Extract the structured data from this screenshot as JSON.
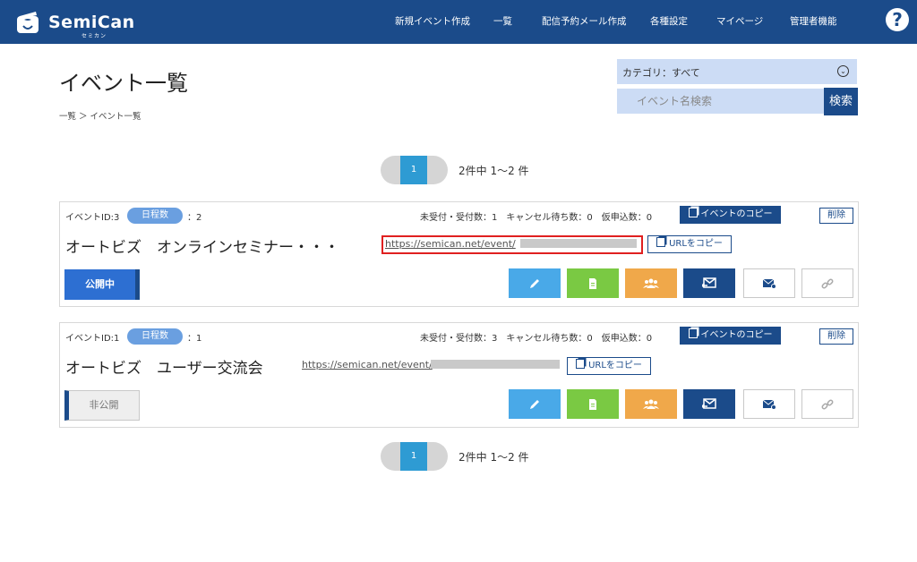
{
  "header": {
    "logo_text": "SemiCan",
    "logo_sub": "セミカン",
    "nav": [
      "新規イベント作成",
      "一覧",
      "配信予約メール作成",
      "各種設定",
      "マイページ",
      "管理者機能"
    ],
    "help_label": "?"
  },
  "page": {
    "title": "イベント一覧",
    "breadcrumb": "一覧 ＞ イベント一覧"
  },
  "filters": {
    "category_label": "カテゴリ：すべて",
    "search_placeholder": "イベント名検索",
    "search_button": "検索"
  },
  "pagination": {
    "current_page": "1",
    "summary": "2件中 1〜2 件"
  },
  "events": [
    {
      "id_label": "イベントID:3",
      "dates_pill": "日程数",
      "dates_count": "：2",
      "stats": "未受付・受付数：1　キャンセル待ち数：0　仮申込数：0",
      "copy_event": "イベントのコピー",
      "delete": "削除",
      "name": "オートビズ　オンラインセミナー・・・",
      "url": "https://semican.net/event/",
      "url_copy": "URLをコピー",
      "status": "公開中",
      "published": true,
      "url_highlighted": true
    },
    {
      "id_label": "イベントID:1",
      "dates_pill": "日程数",
      "dates_count": "：1",
      "stats": "未受付・受付数：3　キャンセル待ち数：0　仮申込数：0",
      "copy_event": "イベントのコピー",
      "delete": "削除",
      "name": "オートビズ　ユーザー交流会",
      "url": "https://semican.net/event/",
      "url_copy": "URLをコピー",
      "status": "非公開",
      "published": false,
      "url_highlighted": false
    }
  ],
  "action_icons": [
    "edit-icon",
    "document-icon",
    "users-icon",
    "reply-mail-icon",
    "mail-send-icon",
    "link-icon"
  ],
  "colors": {
    "header_bg": "#1b4b8a",
    "accent_blue": "#2e9bd3",
    "edit": "#49a9e8",
    "doc": "#7ac943",
    "users": "#f0a84a",
    "highlight_border": "#e02020"
  }
}
